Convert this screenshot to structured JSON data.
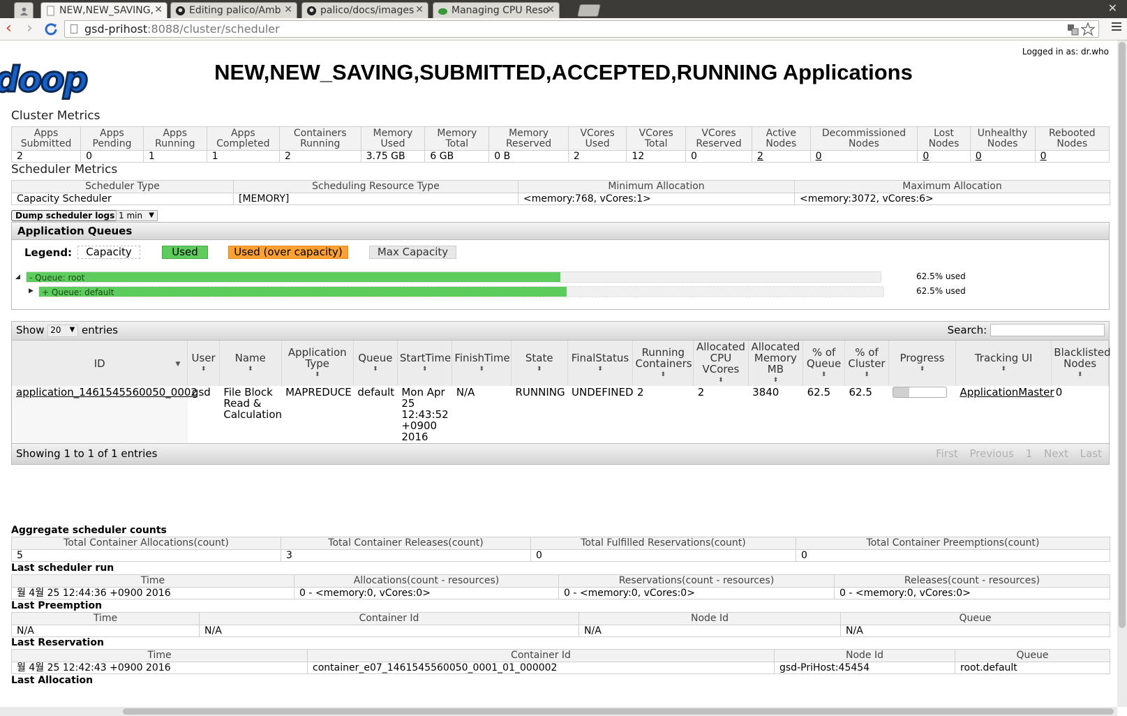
{
  "browser": {
    "tabs": [
      {
        "title": "NEW,NEW_SAVING,"
      },
      {
        "title": "Editing palico/Amb"
      },
      {
        "title": "palico/docs/images"
      },
      {
        "title": "Managing CPU Reso"
      }
    ],
    "url_host": "gsd-prihost",
    "url_rest": ":8088/cluster/scheduler"
  },
  "header": {
    "logo_text": "doop",
    "logged_in": "Logged in as: dr.who",
    "title": "NEW,NEW_SAVING,SUBMITTED,ACCEPTED,RUNNING Applications"
  },
  "cluster_metrics": {
    "title": "Cluster Metrics",
    "headers": [
      "Apps Submitted",
      "Apps Pending",
      "Apps Running",
      "Apps Completed",
      "Containers Running",
      "Memory Used",
      "Memory Total",
      "Memory Reserved",
      "VCores Used",
      "VCores Total",
      "VCores Reserved",
      "Active Nodes",
      "Decommissioned Nodes",
      "Lost Nodes",
      "Unhealthy Nodes",
      "Rebooted Nodes"
    ],
    "values": [
      "2",
      "0",
      "1",
      "1",
      "2",
      "3.75 GB",
      "6 GB",
      "0 B",
      "2",
      "12",
      "0",
      "2",
      "0",
      "0",
      "0",
      "0"
    ]
  },
  "scheduler_metrics": {
    "title": "Scheduler Metrics",
    "headers": [
      "Scheduler Type",
      "Scheduling Resource Type",
      "Minimum Allocation",
      "Maximum Allocation"
    ],
    "values": [
      "Capacity Scheduler",
      "[MEMORY]",
      "<memory:768, vCores:1>",
      "<memory:3072, vCores:6>"
    ]
  },
  "dump": {
    "button": "Dump scheduler logs",
    "interval": "1 min"
  },
  "queues": {
    "title": "Application Queues",
    "legend_label": "Legend:",
    "legend": {
      "capacity": "Capacity",
      "used": "Used",
      "over": "Used (over capacity)",
      "max": "Max Capacity"
    },
    "items": [
      {
        "label": "Queue: root",
        "sign": "-",
        "used_fraction": 0.625,
        "pct_text": "62.5% used"
      },
      {
        "label": "Queue: default",
        "sign": "+",
        "used_fraction": 0.625,
        "pct_text": "62.5% used"
      }
    ],
    "colors": {
      "used": "#5dcc5d",
      "over": "#ffa033"
    }
  },
  "apps": {
    "show_label": "Show",
    "show_value": "20",
    "entries_label": "entries",
    "search_label": "Search:",
    "headers": [
      "ID",
      "User",
      "Name",
      "Application Type",
      "Queue",
      "StartTime",
      "FinishTime",
      "State",
      "FinalStatus",
      "Running Containers",
      "Allocated CPU VCores",
      "Allocated Memory MB",
      "% of Queue",
      "% of Cluster",
      "Progress",
      "Tracking UI",
      "Blacklisted Nodes"
    ],
    "rows": [
      {
        "id": "application_1461545560050_0002",
        "user": "gsd",
        "name": "File Block Read & Calculation",
        "type": "MAPREDUCE",
        "queue": "default",
        "start": "Mon Apr 25 12:43:52 +0900 2016",
        "finish": "N/A",
        "state": "RUNNING",
        "final": "UNDEFINED",
        "running": "2",
        "vcores": "2",
        "memory": "3840",
        "pct_queue": "62.5",
        "pct_cluster": "62.5",
        "progress": 0.3,
        "tracking": "ApplicationMaster",
        "blacklisted": "0"
      }
    ],
    "showing": "Showing 1 to 1 of 1 entries",
    "pager": {
      "first": "First",
      "previous": "Previous",
      "page": "1",
      "next": "Next",
      "last": "Last"
    }
  },
  "aggregate": {
    "title": "Aggregate scheduler counts",
    "headers": [
      "Total Container Allocations(count)",
      "Total Container Releases(count)",
      "Total Fulfilled Reservations(count)",
      "Total Container Preemptions(count)"
    ],
    "values": [
      "5",
      "3",
      "0",
      "0"
    ]
  },
  "last_run": {
    "title": "Last scheduler run",
    "headers": [
      "Time",
      "Allocations(count - resources)",
      "Reservations(count - resources)",
      "Releases(count - resources)"
    ],
    "values": [
      "월 4월 25 12:44:36 +0900 2016",
      "0 - <memory:0, vCores:0>",
      "0 - <memory:0, vCores:0>",
      "0 - <memory:0, vCores:0>"
    ]
  },
  "last_preemption": {
    "title": "Last Preemption",
    "headers": [
      "Time",
      "Container Id",
      "Node Id",
      "Queue"
    ],
    "values": [
      "N/A",
      "N/A",
      "N/A",
      "N/A"
    ]
  },
  "last_reservation": {
    "title": "Last Reservation",
    "headers": [
      "Time",
      "Container Id",
      "Node Id",
      "Queue"
    ],
    "values": [
      "월 4월 25 12:42:43 +0900 2016",
      "container_e07_1461545560050_0001_01_000002",
      "gsd-PriHost:45454",
      "root.default"
    ]
  },
  "last_allocation": {
    "title": "Last Allocation"
  }
}
